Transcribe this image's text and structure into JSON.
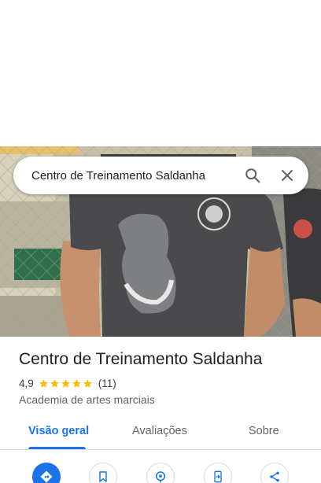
{
  "search": {
    "query": "Centro de Treinamento Saldanha"
  },
  "place": {
    "name": "Centro de Treinamento Saldanha",
    "rating": "4,9",
    "stars": 5,
    "review_count": "(11)",
    "category": "Academia de artes marciais"
  },
  "tabs": [
    {
      "label": "Visão geral",
      "active": true
    },
    {
      "label": "Avaliações",
      "active": false
    },
    {
      "label": "Sobre",
      "active": false
    }
  ],
  "actions": [
    {
      "icon": "directions-icon",
      "primary": true
    },
    {
      "icon": "bookmark-icon",
      "primary": false
    },
    {
      "icon": "nearby-icon",
      "primary": false
    },
    {
      "icon": "send-to-phone-icon",
      "primary": false
    },
    {
      "icon": "share-icon",
      "primary": false
    }
  ],
  "colors": {
    "accent": "#1a73e8",
    "star": "#fbbc04",
    "text": "#202124",
    "muted": "#5f6368"
  }
}
